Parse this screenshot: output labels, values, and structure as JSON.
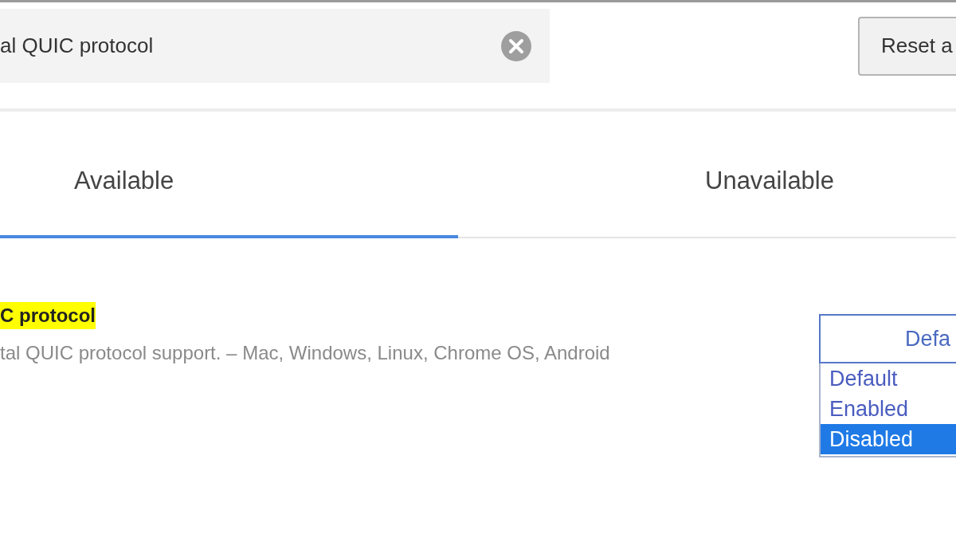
{
  "search": {
    "value": "al QUIC protocol"
  },
  "reset_button": {
    "label": "Reset a"
  },
  "tabs": [
    {
      "label": "Available",
      "selected": true
    },
    {
      "label": "Unavailable",
      "selected": false
    }
  ],
  "flag": {
    "title": "C protocol",
    "description": "tal QUIC protocol support. – Mac, Windows, Linux, Chrome OS, Android",
    "dropdown": {
      "value": "Defa",
      "options": [
        {
          "label": "Default",
          "selected": false
        },
        {
          "label": "Enabled",
          "selected": false
        },
        {
          "label": "Disabled",
          "selected": true
        }
      ]
    }
  }
}
